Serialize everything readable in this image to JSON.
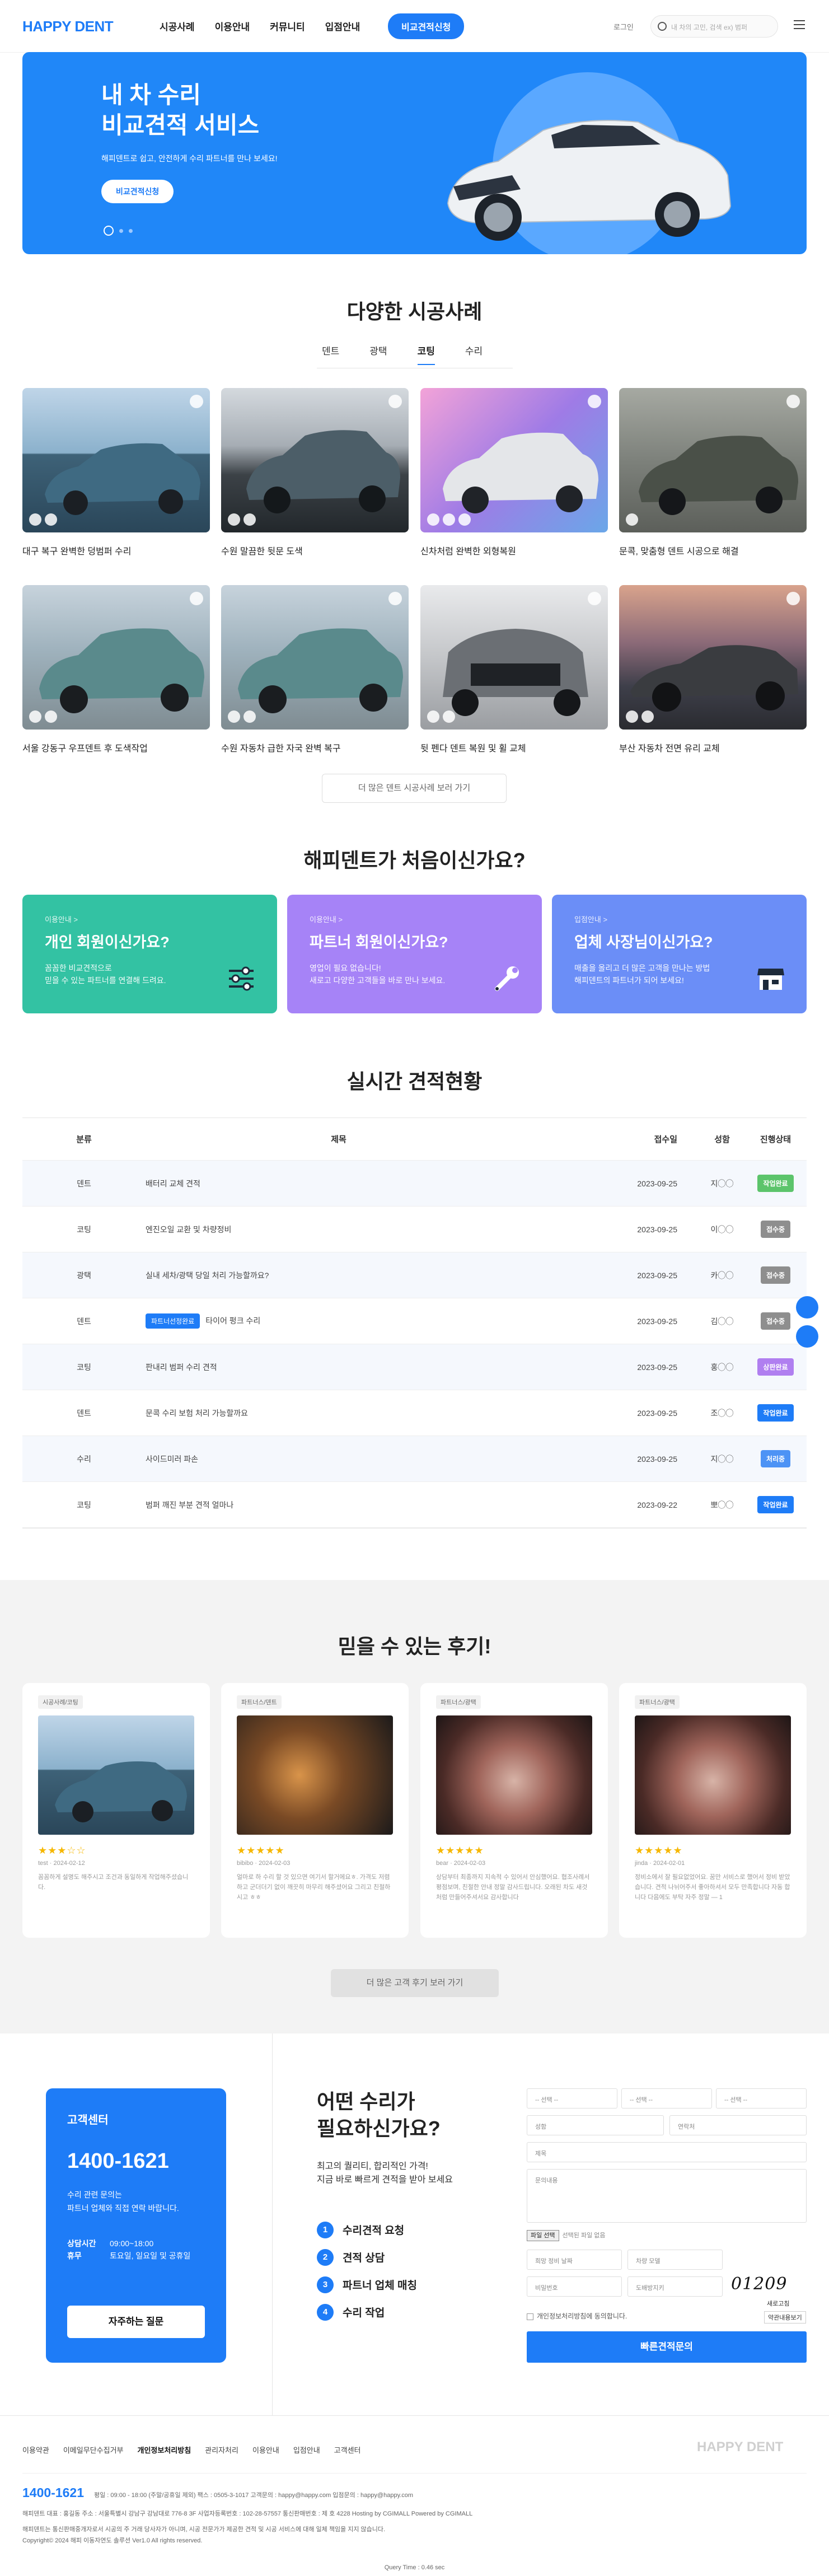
{
  "header": {
    "logo": "HAPPY DENT",
    "nav": [
      "시공사례",
      "이용안내",
      "커뮤니티",
      "입점안내"
    ],
    "cta": "비교견적신청",
    "login": "로그인",
    "search_placeholder": "내 차의 고민, 검색 ex) 범퍼"
  },
  "hero": {
    "title": "내 차 수리\n비교견적 서비스",
    "subtitle": "해피덴트로 쉽고, 안전하게 수리 파트너를 만나 보세요!",
    "button": "비교견적신청"
  },
  "cases": {
    "title": "다양한 시공사례",
    "tabs": [
      "덴트",
      "광택",
      "코팅",
      "수리"
    ],
    "active_tab": "코팅",
    "items": [
      {
        "caption": "대구 복구 완벽한 덩범퍼 수리"
      },
      {
        "caption": "수원 말끔한 뒷문 도색"
      },
      {
        "caption": "신차처럼 완벽한 외형복원"
      },
      {
        "caption": "문콕, 맞춤형 덴트 시공으로 해결"
      },
      {
        "caption": "서울 강동구 우프덴트 후 도색작업"
      },
      {
        "caption": "수원 자동차 급한 자국 완벽 복구"
      },
      {
        "caption": "뒷 펜다 덴트 복원 및 휠 교체"
      },
      {
        "caption": "부산 자동차 전면 유리 교체"
      }
    ],
    "more": "더 많은 덴트 시공사례 보러 가기"
  },
  "first_time": {
    "title": "해피덴트가 처음이신가요?",
    "cards": [
      {
        "kicker": "이용안내 >",
        "title": "개인 회원이신가요?",
        "desc": "꼼꼼한 비교견적으로\n믿을 수 있는 파트너를 연결해 드려요.",
        "color": "#33c2a3",
        "icon": "sliders-icon"
      },
      {
        "kicker": "이용안내 >",
        "title": "파트너 회원이신가요?",
        "desc": "영업이 필요 없습니다!\n새로고 다양한 고객들을 바로 만나 보세요.",
        "color": "#a683f7",
        "icon": "wrench-icon"
      },
      {
        "kicker": "입점안내 >",
        "title": "업체 사장님이신가요?",
        "desc": "매출을 올리고 더 많은 고객을 만나는 방법\n해피덴트의 파트너가 되어 보세요!",
        "color": "#6b8ef7",
        "icon": "store-icon"
      }
    ]
  },
  "estimates": {
    "title": "실시간 견적현황",
    "headers": [
      "분류",
      "제목",
      "접수일",
      "성함",
      "진행상태"
    ],
    "rows": [
      {
        "cat": "덴트",
        "tag": "",
        "title": "배터리 교체 견적",
        "date": "2023-09-25",
        "name": "지◯◯",
        "status": "작업완료",
        "color": "#5cc46b"
      },
      {
        "cat": "코팅",
        "tag": "",
        "title": "엔진오일 교환 및 차량정비",
        "date": "2023-09-25",
        "name": "이◯◯",
        "status": "접수중",
        "color": "#8e8e8e"
      },
      {
        "cat": "광택",
        "tag": "",
        "title": "실내 세차/광택 당일 처리 가능할까요?",
        "date": "2023-09-25",
        "name": "카◯◯",
        "status": "접수중",
        "color": "#8e8e8e"
      },
      {
        "cat": "덴트",
        "tag": "파트너선정완료",
        "title": "타이어 펑크 수리",
        "date": "2023-09-25",
        "name": "김◯◯",
        "status": "접수중",
        "color": "#8e8e8e"
      },
      {
        "cat": "코팅",
        "tag": "",
        "title": "판내리 범퍼 수리 견적",
        "date": "2023-09-25",
        "name": "홍◯◯",
        "status": "상판완료",
        "color": "#b07ff0"
      },
      {
        "cat": "덴트",
        "tag": "",
        "title": "문콕 수리 보험 처리 가능할까요",
        "date": "2023-09-25",
        "name": "조◯◯",
        "status": "작업완료",
        "color": "#1e7cf7"
      },
      {
        "cat": "수리",
        "tag": "",
        "title": "사이드미러 파손",
        "date": "2023-09-25",
        "name": "지◯◯",
        "status": "처리중",
        "color": "#4d93f5"
      },
      {
        "cat": "코팅",
        "tag": "",
        "title": "범퍼 깨진 부분 견적 얼마나",
        "date": "2023-09-22",
        "name": "뽀◯◯",
        "status": "작업완료",
        "color": "#1e7cf7"
      }
    ]
  },
  "reviews": {
    "title": "믿을 수 있는 후기!",
    "items": [
      {
        "cat": "시공사례/코팅",
        "stars": "★★★☆☆",
        "meta": "test · 2024-02-12",
        "text": "꼼꼼하게 설명도 해주시고 조건과 동일하게 작업해주셨습니다."
      },
      {
        "cat": "파트너스/덴트",
        "stars": "★★★★★",
        "meta": "bibibo · 2024-02-03",
        "text": "얼마로 하 수리 할 것 있으면 여기서 할거에요ㅎ. 가격도 저렴 하고 군더더기 없이 깨끗히 마무리 해주셨어요 그리고 친절하시고 ㅎㅎ"
      },
      {
        "cat": "파트너스/광택",
        "stars": "★★★★★",
        "meta": "bear · 2024-02-03",
        "text": "상담부터 최종까지 지속적 수 있어서 안심했어요. 협조사례서 평점보며, 친절한 안내 정말 감사드립니다. 오래된 차도 새것처럼 만들어주셔서요 감사합니다"
      },
      {
        "cat": "파트너스/광택",
        "stars": "★★★★★",
        "meta": "jinda · 2024-02-01",
        "text": "정비소에서 잘 필요없었어요. 꿈만 서비스로 했어서 정비 받았습니다. 견적 나뉘어주서 좋아하셔서 모두 만족합니다 자동 합니다 다음에도 부탁 자주 정말 — 1"
      }
    ],
    "more": "더 많은 고객 후기 보러 가기"
  },
  "contact": {
    "title": "고객센터",
    "phone": "1400-1621",
    "desc": "수리 관련 문의는\n파트너 업체와 직접 연락 바랍니다.",
    "hours_label": "상담시간",
    "hours": "09:00~18:00",
    "off_label": "휴무",
    "off": "토요일, 일요일 및 공휴일",
    "faq": "자주하는 질문"
  },
  "form": {
    "title": "어떤 수리가\n필요하신가요?",
    "subtitle": "최고의 퀄리티, 합리적인 가격!\n지금 바로 빠르게 견적을 받아 보세요",
    "steps": [
      "수리견적 요청",
      "견적 상담",
      "파트너 업체 매칭",
      "수리 작업"
    ],
    "select1": "-- 선택 --",
    "select2": "-- 선택 --",
    "select3": "-- 선택 --",
    "name": "성함",
    "phone": "연락처",
    "title_field": "제목",
    "content": "문의내용",
    "file_btn": "파일 선택",
    "file_ph": "선택된 파일 없음",
    "car_no": "희망 정비 날짜",
    "model": "차량 모델",
    "password": "비밀번호",
    "captcha": "도배방지키",
    "captcha_code": "01209",
    "refresh": "새로고침",
    "agree": "개인정보처리방침에 동의합니다.",
    "view": "약관내용보기",
    "submit": "빠른견적문의"
  },
  "footer": {
    "links": [
      "이용약관",
      "이메일무단수집거부",
      "개인정보처리방침",
      "관리자처리",
      "이용안내",
      "입점안내",
      "고객센터"
    ],
    "logo": "HAPPY DENT",
    "phone": "1400-1621",
    "hours": "평일 : 09:00 - 18:00 (주말/공휴일 제외)   팩스 : 0505-3-1017   고객문의 : happy@happy.com   입점문의 : happy@happy.com",
    "company": "해피덴트   대표 : 홍길동   주소 : 서울특별시 강남구 강남대로 776-8 3F   사업자등록번호 : 102-28-57557   통신판매번호 : 제 호 4228   Hosting by CGIMALL   Powered by CGIMALL",
    "notice": "해피덴트는 통신판매중개자로서 시공의 주 거래 당사자가 아니며, 시공 전문가가 제공한 견적 및 시공 서비스에 대해 일체 책임을 지지 않습니다.",
    "copyright": "Copyright© 2024 해피 이동자연도 솔루션 Ver1.0 All rights reserved.",
    "query_time": "Query Time : 0.46 sec"
  }
}
